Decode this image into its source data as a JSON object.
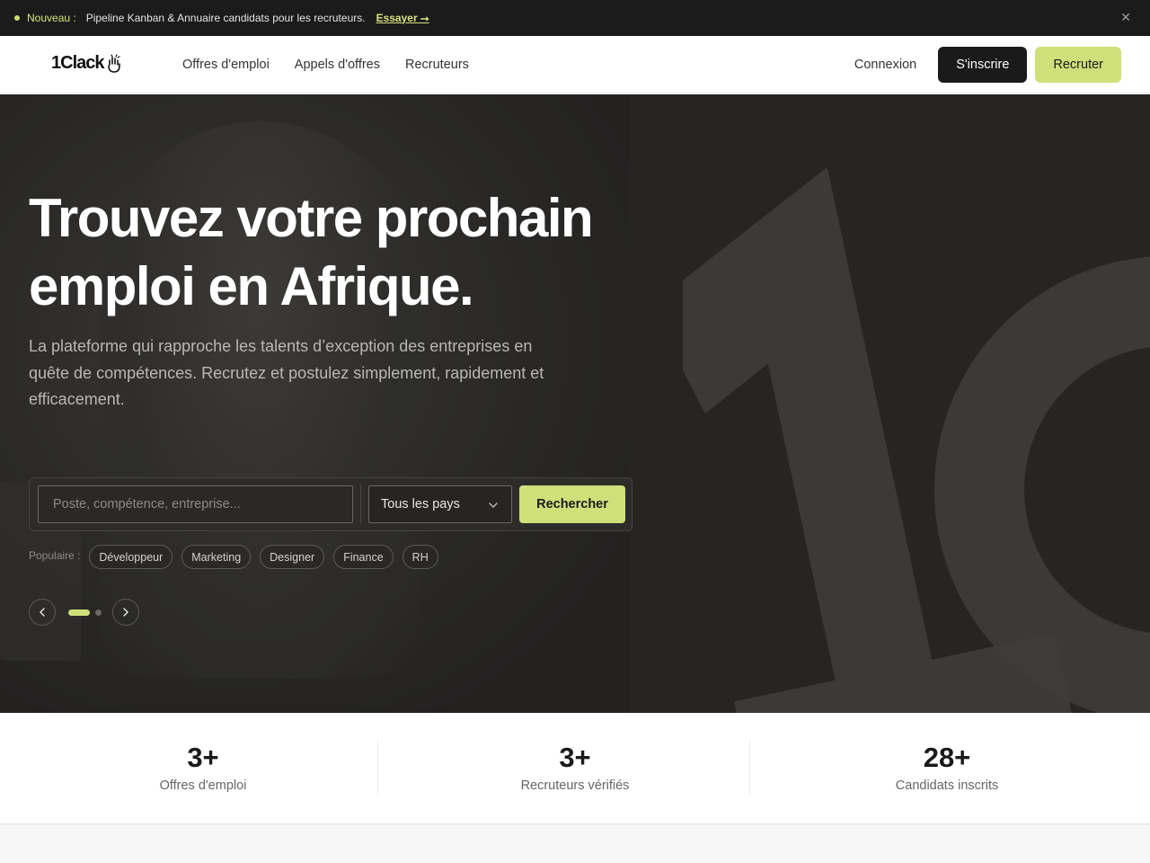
{
  "announcement": {
    "tag": "Nouveau :",
    "message": "Pipeline Kanban & Annuaire candidats pour les recruteurs.",
    "cta": "Essayer ⭢"
  },
  "nav": {
    "logo": "1Clack",
    "links": [
      "Offres d'emploi",
      "Appels d'offres",
      "Recruteurs"
    ],
    "login": "Connexion",
    "signup": "S'inscrire",
    "recruit": "Recruter"
  },
  "hero": {
    "title_line1": "Trouvez votre prochain",
    "title_line2": "emploi en Afrique.",
    "subtitle": "La plateforme qui rapproche les talents d’exception des entreprises en quête de compétences. Recrutez et postulez simplement, rapidement et efficacement.",
    "search": {
      "placeholder": "Poste, compétence, entreprise...",
      "value": "",
      "country_selected": "Tous les pays",
      "button": "Rechercher"
    },
    "popular_label": "Populaire :",
    "popular_tags": [
      "Développeur",
      "Marketing",
      "Designer",
      "Finance",
      "RH"
    ],
    "carousel": {
      "slides": 2,
      "active": 1
    }
  },
  "stats": [
    {
      "value": "3+",
      "label": "Offres d'emploi"
    },
    {
      "value": "3+",
      "label": "Recruteurs vérifiés"
    },
    {
      "value": "28+",
      "label": "Candidats inscrits"
    }
  ],
  "colors": {
    "accent": "#cfe07a",
    "dark": "#1b1b1b",
    "hero_bg": "#262524"
  }
}
